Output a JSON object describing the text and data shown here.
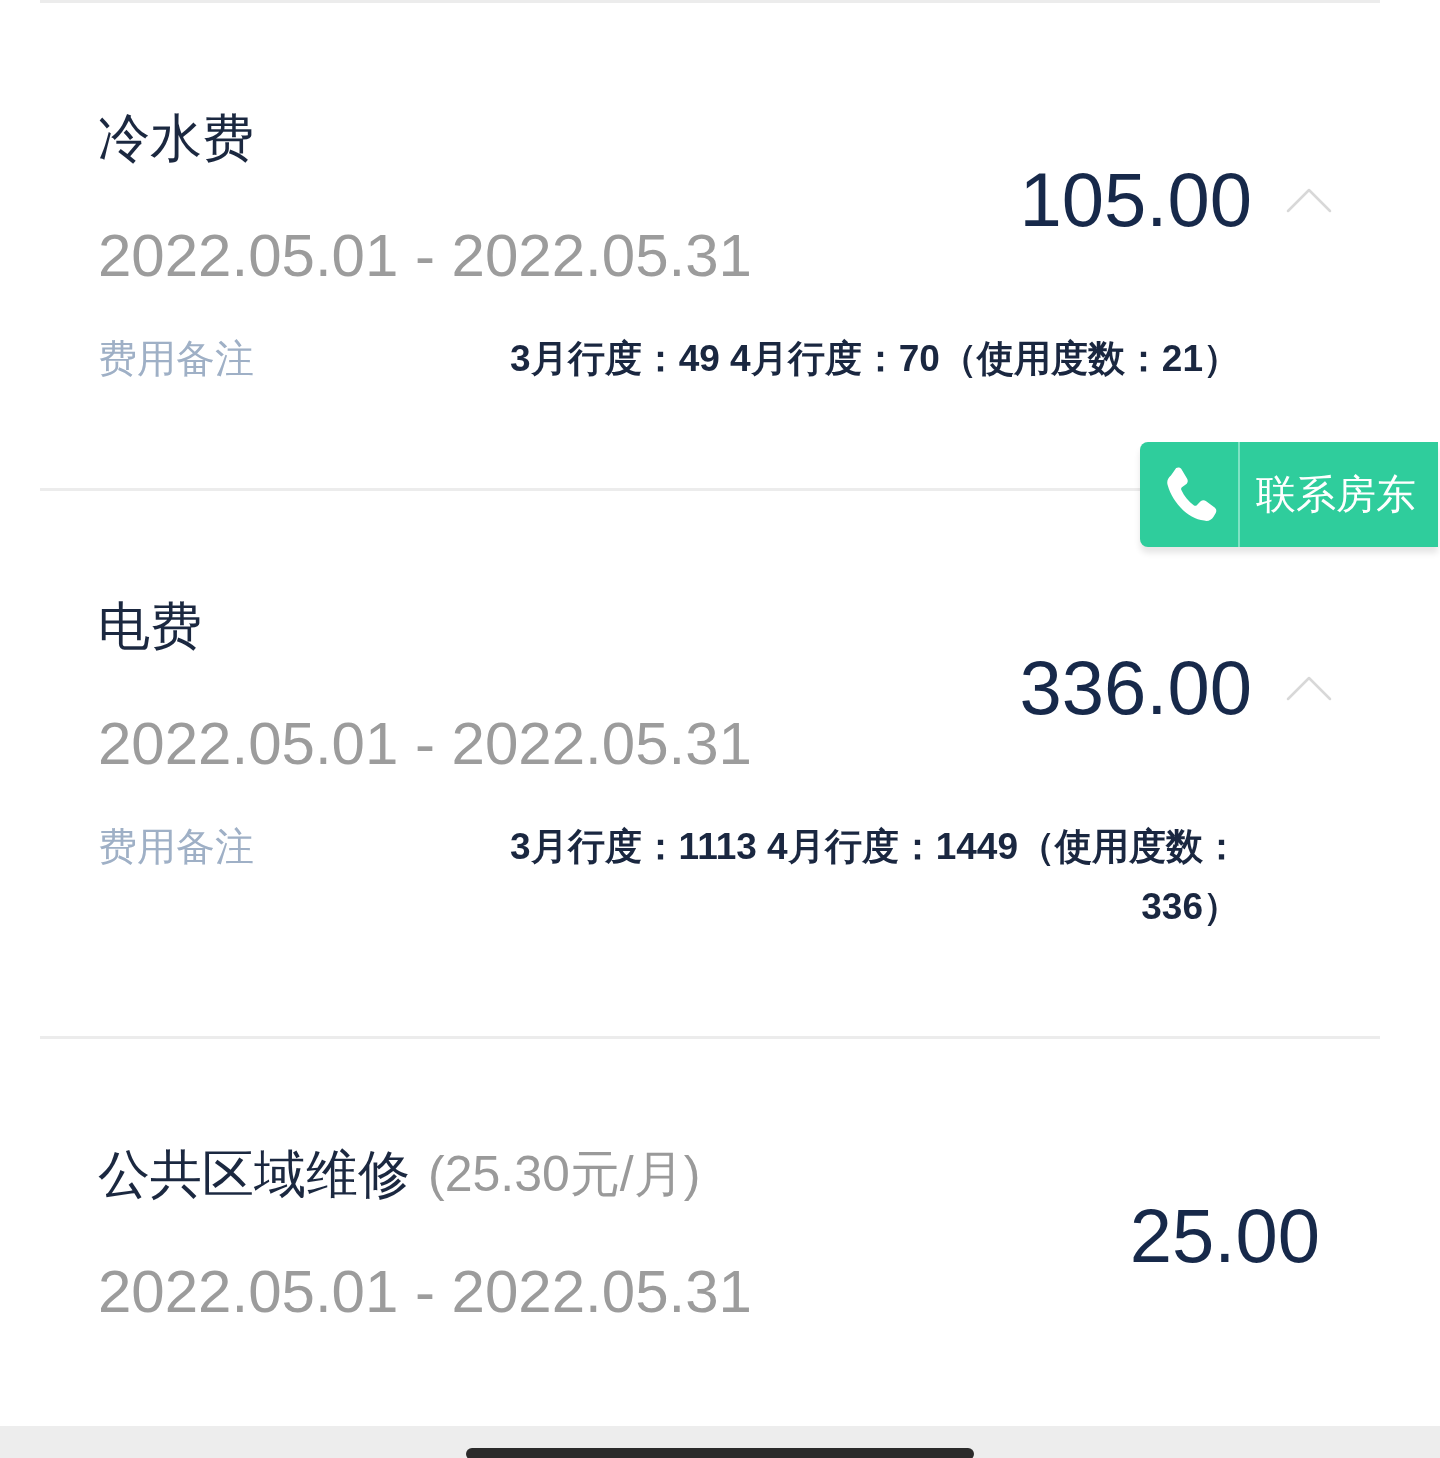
{
  "fees": [
    {
      "kind": "expandable",
      "title": "冷水费",
      "period": "2022.05.01 - 2022.05.31",
      "amount": "105.00",
      "expanded": true,
      "note": {
        "label": "费用备注",
        "text": "3月行度：49 4月行度：70（使用度数：21）"
      }
    },
    {
      "kind": "expandable",
      "title": "电费",
      "period": "2022.05.01 - 2022.05.31",
      "amount": "336.00",
      "expanded": true,
      "note": {
        "label": "费用备注",
        "text": "3月行度：1113 4月行度：1449（使用度数：336）"
      }
    },
    {
      "kind": "fixed",
      "title": "公共区域维修",
      "rate": "(25.30元/月)",
      "period": "2022.05.01 - 2022.05.31",
      "amount": "25.00"
    }
  ],
  "contact_button": {
    "label": "联系房东"
  }
}
